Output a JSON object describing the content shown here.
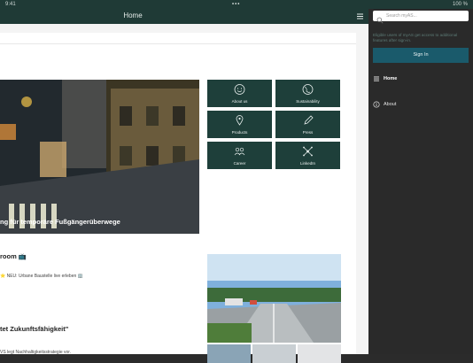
{
  "status_bar": {
    "time": "9:41",
    "dots": "•••",
    "right": "100 %"
  },
  "header": {
    "title": "Home"
  },
  "hero": {
    "caption": "ng für temporäre Fußgängerüberwege"
  },
  "tiles": [
    {
      "label": "About us",
      "icon": "smiley-icon"
    },
    {
      "label": "Sustainability",
      "icon": "globe-icon"
    },
    {
      "label": "Products",
      "icon": "location-icon"
    },
    {
      "label": "Press",
      "icon": "pen-icon"
    },
    {
      "label": "Career",
      "icon": "people-icon"
    },
    {
      "label": "LinkedIn",
      "icon": "network-icon"
    }
  ],
  "newsroom": {
    "title": "room 📺",
    "item": "⭐ NEU: Urbane Baustelle live erleben 🏢"
  },
  "story": {
    "title": "tet Zukunftsfähigkeit\"",
    "subtitle": "VS legt Nachhaltigkeitsstrategie vor."
  },
  "drawer": {
    "search_placeholder": "Search myAS...",
    "note": "Eligible users of myAS get access to additional features after sign-in.",
    "signin_label": "Sign In",
    "nav": [
      {
        "label": "Home",
        "icon": "list-icon",
        "active": true
      },
      {
        "label": "About",
        "icon": "info-icon",
        "active": false
      }
    ]
  },
  "colors": {
    "brand": "#1e3f3a",
    "accent": "#1a5a6b",
    "drawer": "#2a2a2a"
  }
}
